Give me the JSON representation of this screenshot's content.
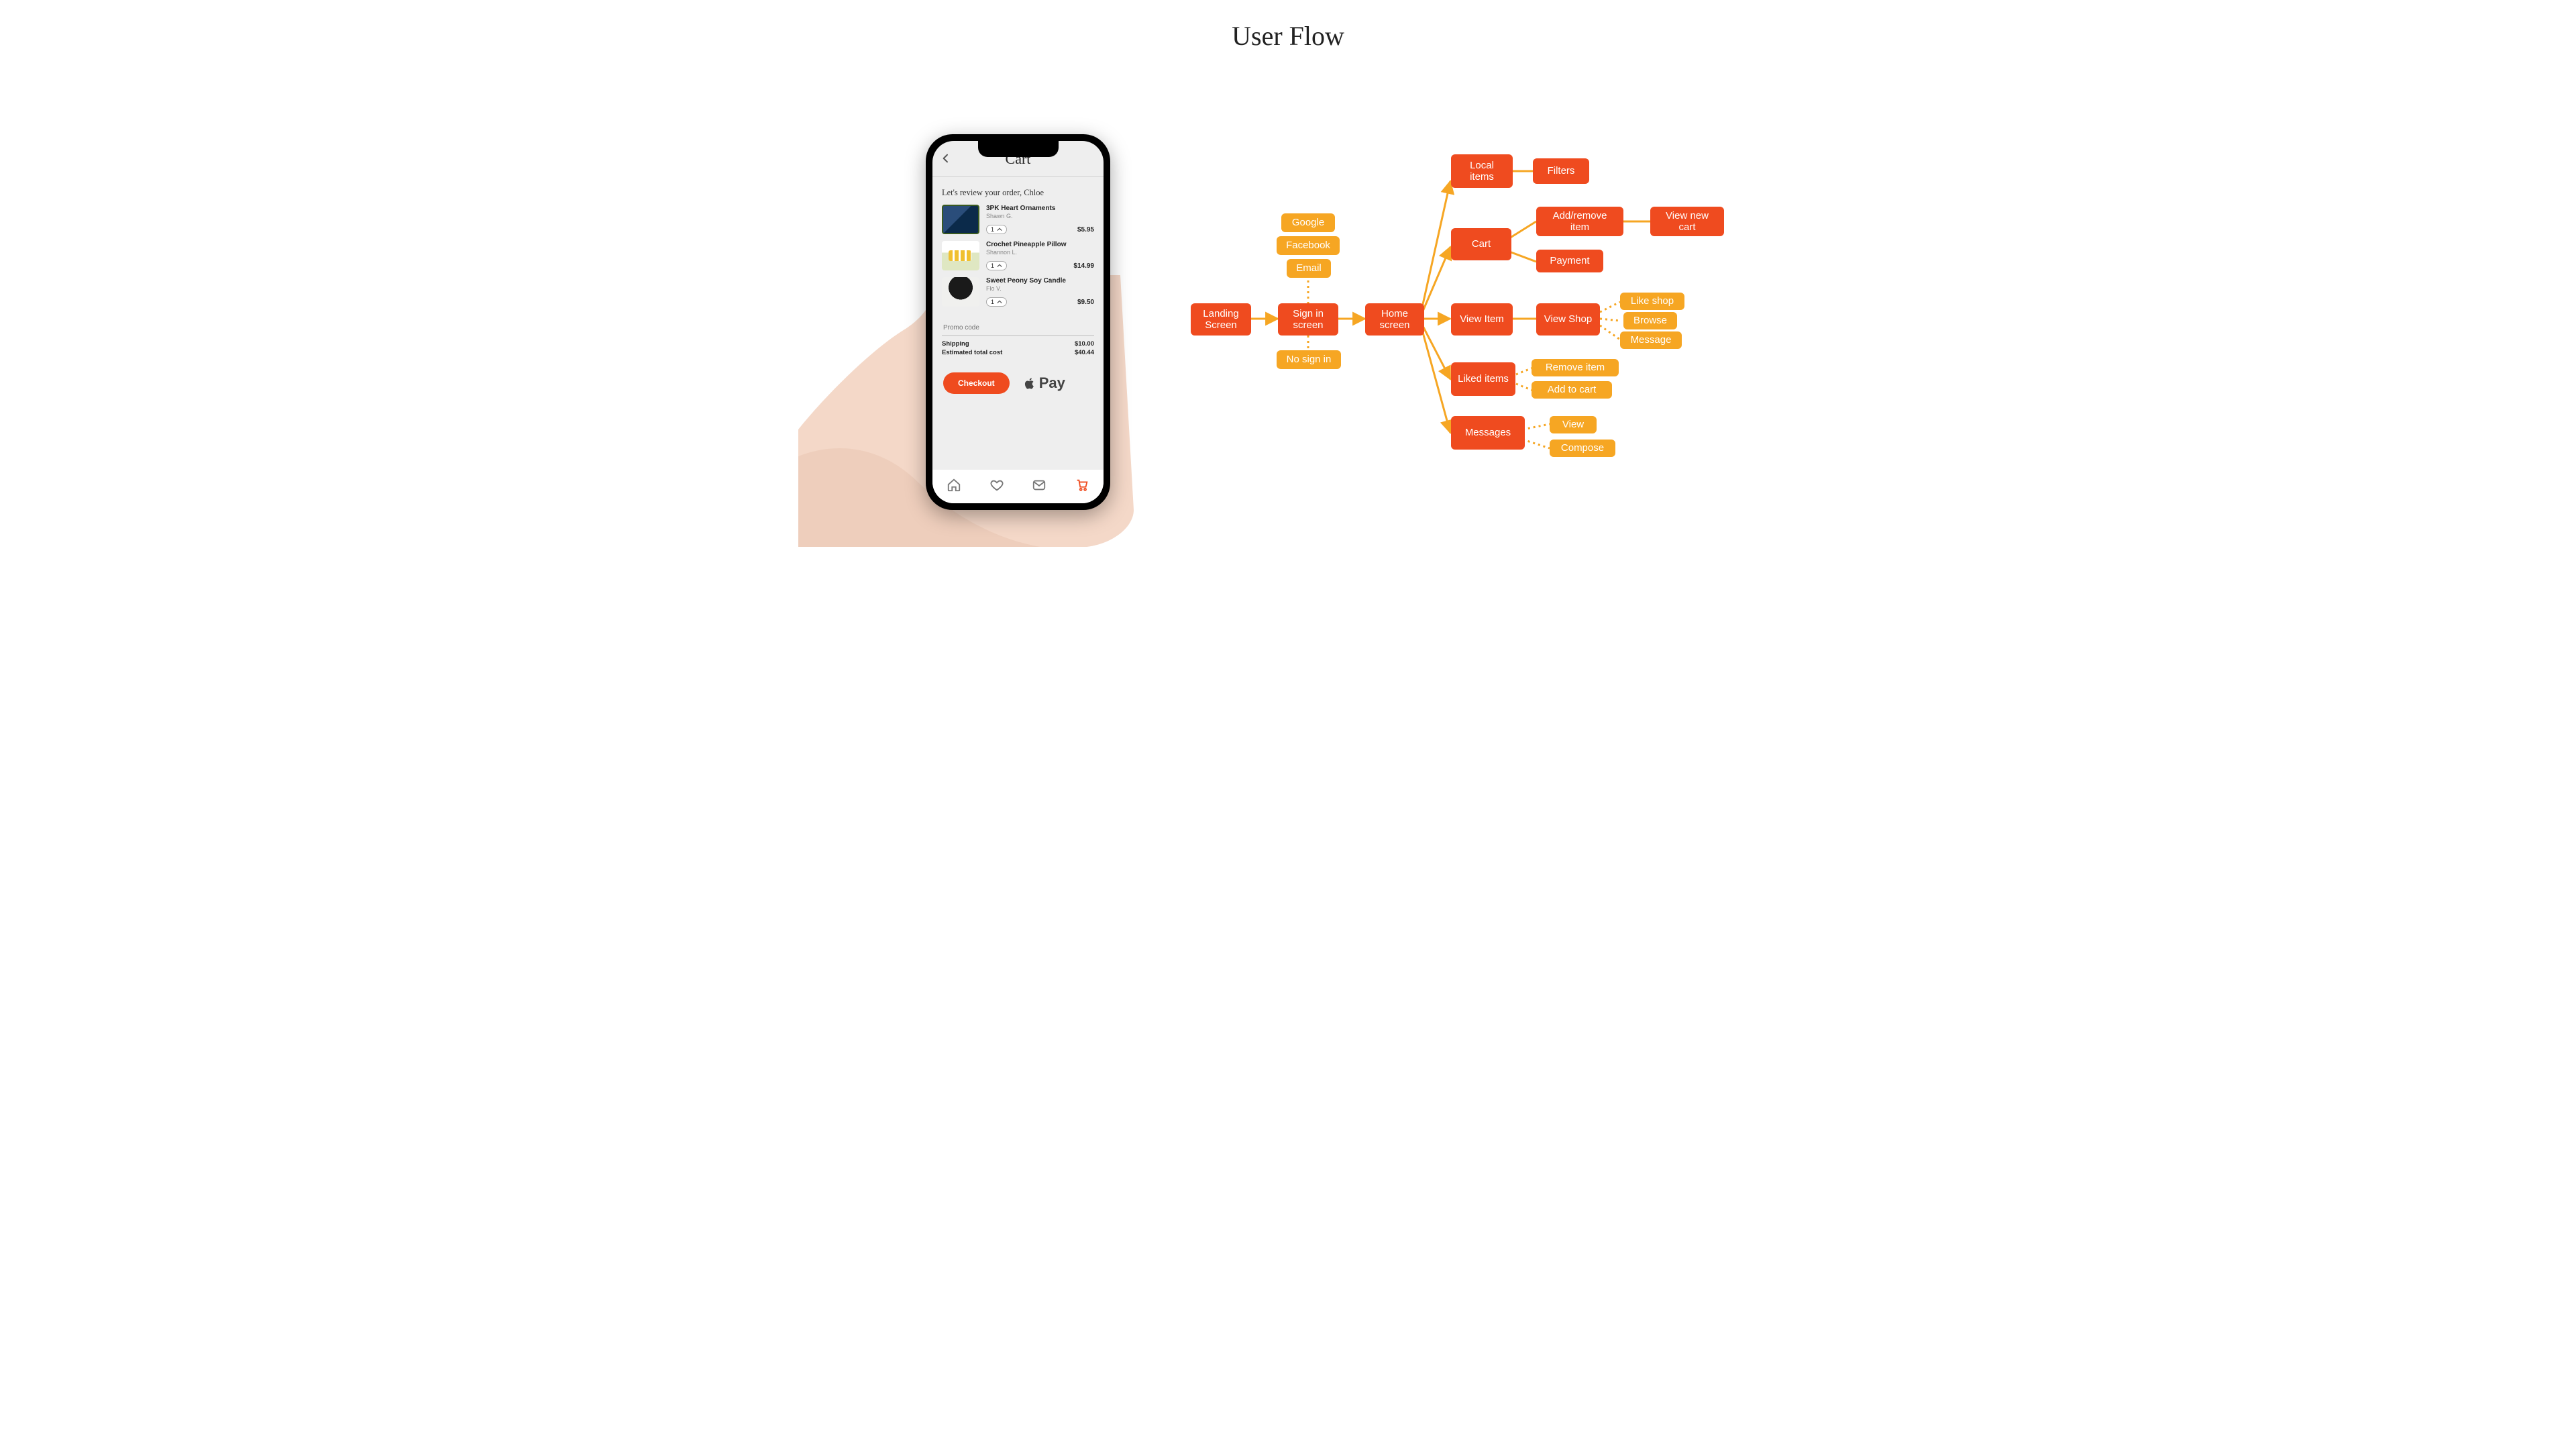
{
  "title": "User Flow",
  "phone": {
    "app_title": "Cart",
    "greeting": "Let's review your order, Chloe",
    "items": [
      {
        "name": "3PK Heart Ornaments",
        "seller": "Shawn G.",
        "qty": "1",
        "price": "$5.95"
      },
      {
        "name": "Crochet Pineapple Pillow",
        "seller": "Shannon L.",
        "qty": "1",
        "price": "$14.99"
      },
      {
        "name": "Sweet Peony Soy Candle",
        "seller": "Flo V.",
        "qty": "1",
        "price": "$9.50"
      }
    ],
    "promo_placeholder": "Promo code",
    "shipping_label": "Shipping",
    "shipping_value": "$10.00",
    "total_label": "Estimated total cost",
    "total_value": "$40.44",
    "checkout_label": "Checkout",
    "applepay_label": "Pay"
  },
  "flow": {
    "landing": "Landing Screen",
    "signin": "Sign in screen",
    "google": "Google",
    "facebook": "Facebook",
    "email": "Email",
    "no_signin": "No sign in",
    "home": "Home screen",
    "local_items": "Local items",
    "filters": "Filters",
    "cart": "Cart",
    "add_remove": "Add/remove item",
    "payment": "Payment",
    "view_new_cart": "View new cart",
    "view_item": "View Item",
    "view_shop": "View Shop",
    "like_shop": "Like shop",
    "browse": "Browse",
    "message": "Message",
    "liked_items": "Liked items",
    "remove_item": "Remove item",
    "add_to_cart": "Add to cart",
    "messages": "Messages",
    "view": "View",
    "compose": "Compose"
  }
}
